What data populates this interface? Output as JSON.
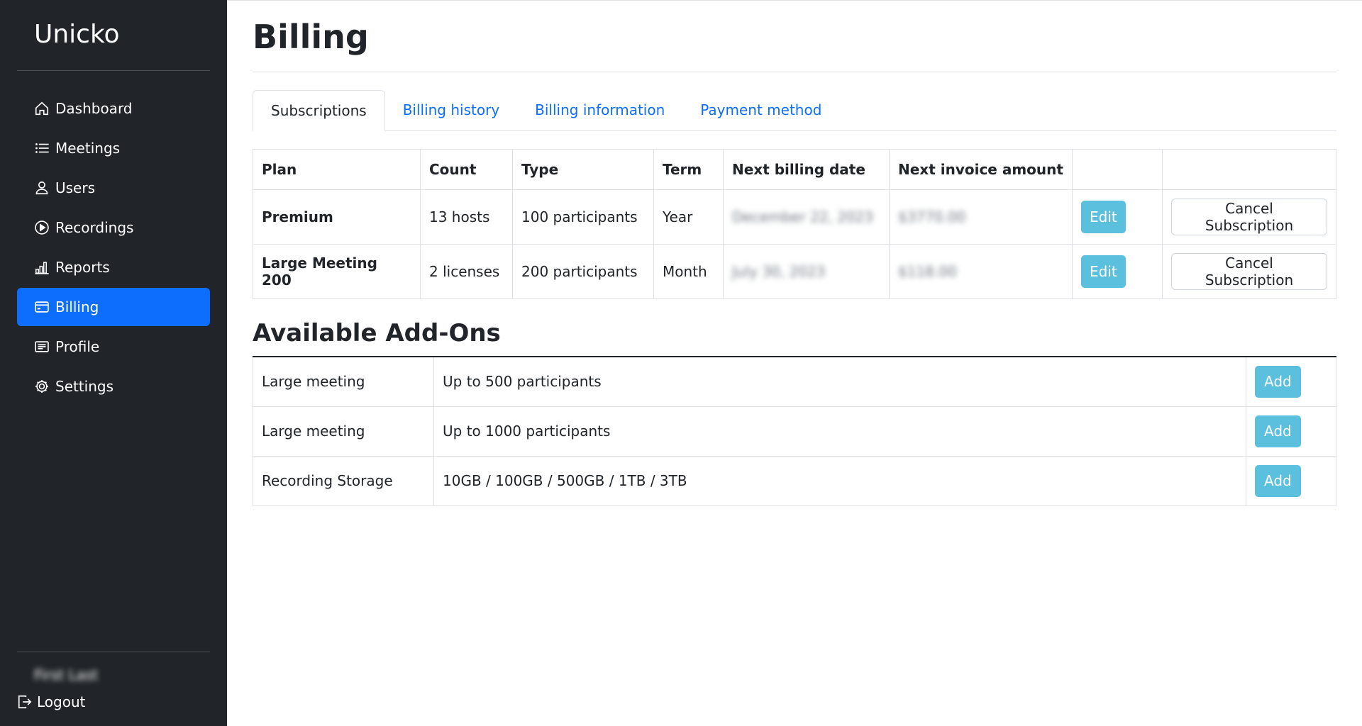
{
  "brand": "Unicko",
  "nav": [
    {
      "label": "Dashboard",
      "icon": "house-icon",
      "active": false
    },
    {
      "label": "Meetings",
      "icon": "list-icon",
      "active": false
    },
    {
      "label": "Users",
      "icon": "person-icon",
      "active": false
    },
    {
      "label": "Recordings",
      "icon": "play-circle-icon",
      "active": false
    },
    {
      "label": "Reports",
      "icon": "bar-chart-icon",
      "active": false
    },
    {
      "label": "Billing",
      "icon": "credit-card-icon",
      "active": true
    },
    {
      "label": "Profile",
      "icon": "card-text-icon",
      "active": false
    },
    {
      "label": "Settings",
      "icon": "gear-icon",
      "active": false
    }
  ],
  "user": {
    "name": "First Last"
  },
  "logout_label": "Logout",
  "page_title": "Billing",
  "tabs": [
    "Subscriptions",
    "Billing history",
    "Billing information",
    "Payment method"
  ],
  "subscriptions": {
    "headers": [
      "Plan",
      "Count",
      "Type",
      "Term",
      "Next billing date",
      "Next invoice amount"
    ],
    "rows": [
      {
        "plan": "Premium",
        "count": "13 hosts",
        "type": "100 participants",
        "term": "Year",
        "next_date": "December 22, 2023",
        "amount": "$3770.00",
        "edit": "Edit",
        "cancel": "Cancel Subscription"
      },
      {
        "plan": "Large Meeting 200",
        "count": "2 licenses",
        "type": "200 participants",
        "term": "Month",
        "next_date": "July 30, 2023",
        "amount": "$118.00",
        "edit": "Edit",
        "cancel": "Cancel Subscription"
      }
    ]
  },
  "addons": {
    "title": "Available Add-Ons",
    "rows": [
      {
        "name": "Large meeting",
        "desc": "Up to 500 participants",
        "action": "Add"
      },
      {
        "name": "Large meeting",
        "desc": "Up to 1000 participants",
        "action": "Add"
      },
      {
        "name": "Recording Storage",
        "desc": "10GB / 100GB / 500GB / 1TB / 3TB",
        "action": "Add"
      }
    ]
  },
  "colors": {
    "sidebar_bg": "#212529",
    "accent": "#0d6efd",
    "info": "#5bc0de"
  }
}
